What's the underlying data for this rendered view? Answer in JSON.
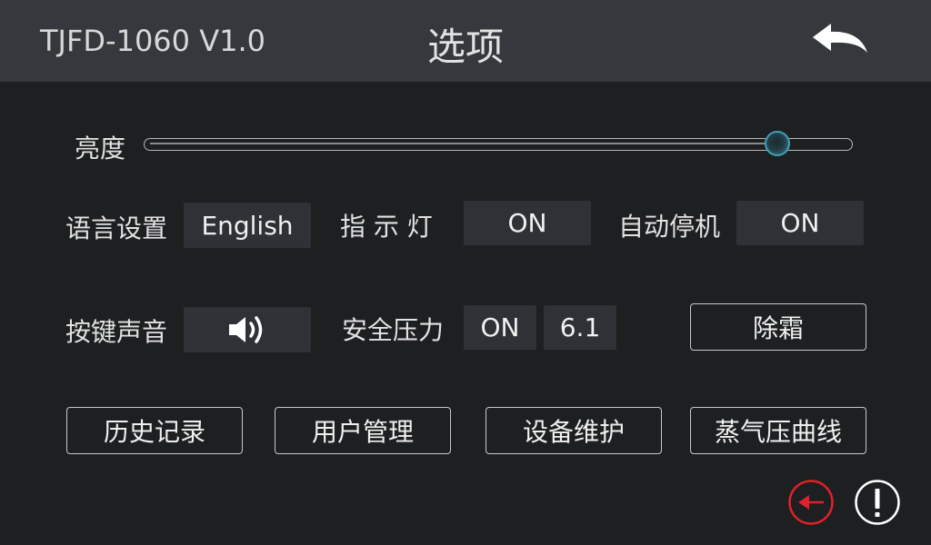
{
  "header": {
    "model": "TJFD-1060 V1.0",
    "title": "选项",
    "back_icon": "back-arrow-icon"
  },
  "brightness": {
    "label": "亮度",
    "level": 0.9
  },
  "row1": {
    "language_label": "语言设置",
    "language_value": "English",
    "indicator_label": "指 示 灯",
    "indicator_value": "ON",
    "auto_stop_label": "自动停机",
    "auto_stop_value": "ON"
  },
  "row2": {
    "key_sound_label": "按键声音",
    "key_sound_icon": "speaker-icon",
    "safety_pressure_label": "安全压力",
    "safety_pressure_state": "ON",
    "safety_pressure_value": "6.1",
    "defrost_button": "除霜"
  },
  "row3": {
    "history_button": "历史记录",
    "user_mgmt_button": "用户管理",
    "device_maint_button": "设备维护",
    "steam_curve_button": "蒸气压曲线"
  },
  "footer": {
    "exit_icon": "exit-arrow-icon",
    "alarm_icon": "alert-icon"
  },
  "colors": {
    "background": "#1d1f21",
    "header": "#35393d",
    "value_box": "#2e3236",
    "accent_red": "#e0202a",
    "slider_thumb": "#3aa5bd"
  }
}
